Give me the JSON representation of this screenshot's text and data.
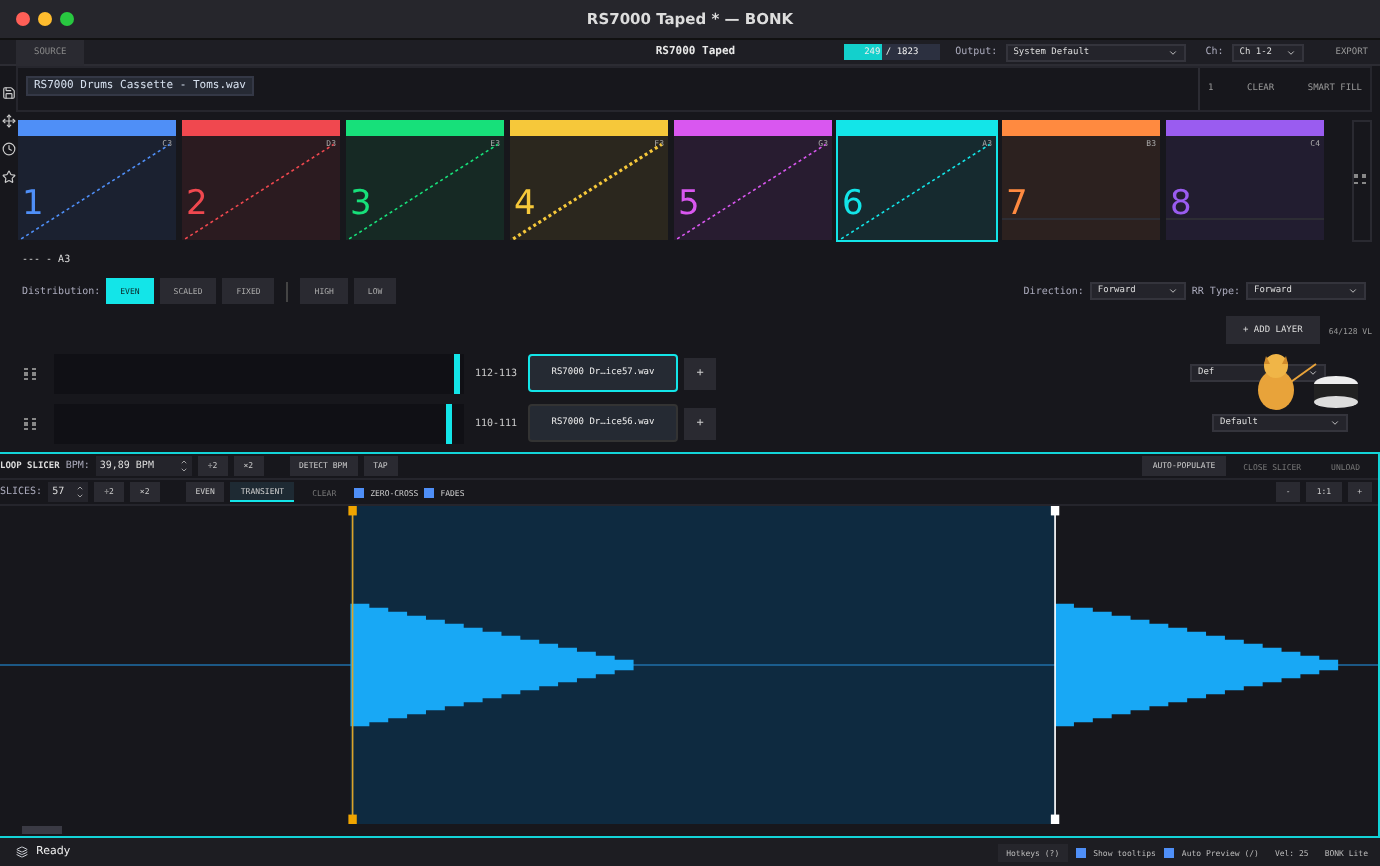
{
  "window": {
    "title": "RS7000 Taped * — BONK"
  },
  "toolbar": {
    "source_tab": "SOURCE",
    "project": "RS7000 Taped",
    "progress": {
      "text": "249 / 1823",
      "level": 0.4
    },
    "output_label": "Output:",
    "output_value": "System Default",
    "channel_label": "Ch:",
    "channel_value": "Ch 1-2",
    "export": "EXPORT"
  },
  "file_chip": "RS7000 Drums Cassette - Toms.wav",
  "side_actions": [
    "1",
    "CLEAR",
    "SMART FILL"
  ],
  "pads": [
    {
      "number": "1",
      "note": "C3",
      "color": "#4f8ff7",
      "selected": false,
      "kind": "line"
    },
    {
      "number": "2",
      "note": "D3",
      "color": "#f0484f",
      "selected": false,
      "kind": "line"
    },
    {
      "number": "3",
      "note": "E3",
      "color": "#17e07a",
      "selected": false,
      "kind": "line"
    },
    {
      "number": "4",
      "note": "F3",
      "color": "#f6c83a",
      "selected": false,
      "kind": "dotted"
    },
    {
      "number": "5",
      "note": "G3",
      "color": "#d957f0",
      "selected": false,
      "kind": "line"
    },
    {
      "number": "6",
      "note": "A3",
      "color": "#13e5e8",
      "selected": true,
      "kind": "line"
    },
    {
      "number": "7",
      "note": "B3",
      "color": "#ff8a40",
      "selected": false,
      "kind": "empty"
    },
    {
      "number": "8",
      "note": "C4",
      "color": "#9a5cf0",
      "selected": false,
      "kind": "empty"
    }
  ],
  "zone": {
    "title": "--- - A3",
    "distribution_label": "Distribution:",
    "modes": [
      {
        "label": "EVEN",
        "selected": true
      },
      {
        "label": "SCALED",
        "selected": false
      },
      {
        "label": "FIXED",
        "selected": false
      }
    ],
    "ranges": [
      "HIGH",
      "LOW"
    ],
    "direction_label": "Direction:",
    "direction": "Forward",
    "rr_label": "RR Type:",
    "rr_value": "Forward",
    "add_layer": "+ ADD LAYER",
    "count": "64/128 VL"
  },
  "layers": [
    {
      "range": "112-113",
      "file": "RS7000 Dr…ice57.wav",
      "selected": true,
      "level": 0.99,
      "add": "+",
      "dropdown": "Def"
    },
    {
      "range": "110-111",
      "file": "RS7000 Dr…ice56.wav",
      "selected": false,
      "level": 0.97,
      "add": "+",
      "dropdown": "Default"
    }
  ],
  "slicer": {
    "title": "LOOP SLICER",
    "bpm_label": "BPM:",
    "bpm": "39,89 BPM",
    "bpm_buttons": [
      "÷2",
      "×2"
    ],
    "detect": "DETECT BPM",
    "tap": "TAP",
    "auto": "AUTO-POPULATE",
    "close": "CLOSE SLICER",
    "unload": "UNLOAD",
    "slices_label": "SLICES:",
    "slices": "57",
    "slice_buttons": [
      "÷2",
      "×2"
    ],
    "modes": [
      {
        "label": "EVEN",
        "selected": false
      },
      {
        "label": "TRANSIENT",
        "selected": true
      }
    ],
    "clear": "CLEAR",
    "options": [
      {
        "label": "ZERO-CROSS",
        "checked": true
      },
      {
        "label": "FADES",
        "checked": true
      }
    ],
    "zoom": [
      "-",
      "1:1",
      "+"
    ]
  },
  "status": {
    "text": "Ready",
    "hotkeys": "Hotkeys (?)",
    "toggles": [
      {
        "label": "Show tooltips",
        "checked": true
      },
      {
        "label": "Auto Preview (/)",
        "checked": true
      }
    ],
    "vel": "Vel: 25",
    "edition": "BONK Lite"
  }
}
